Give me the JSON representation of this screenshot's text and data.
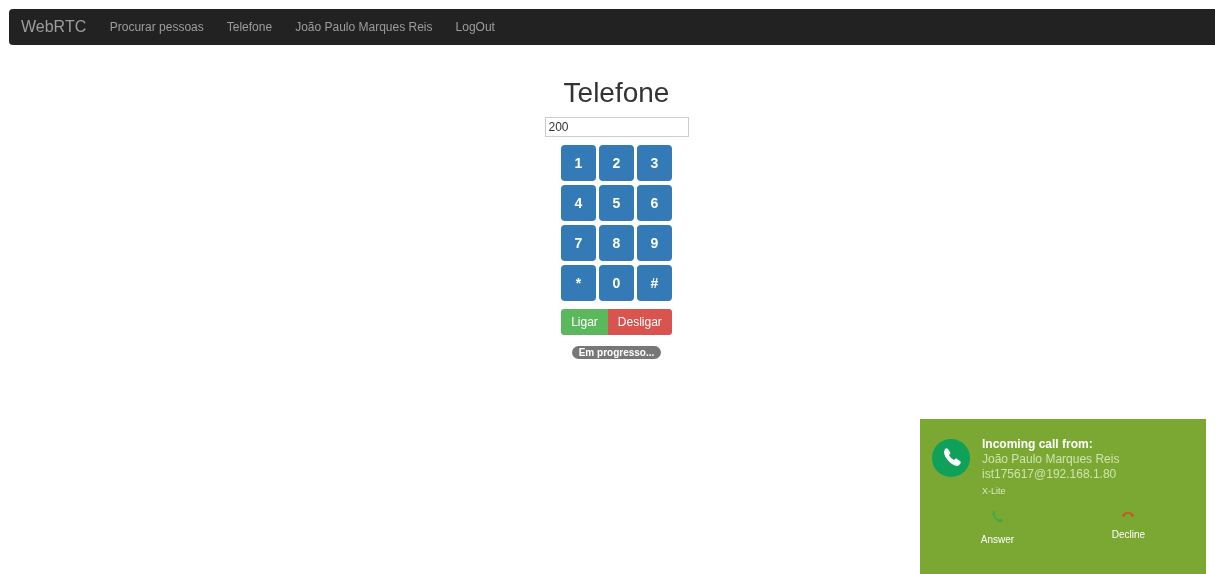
{
  "navbar": {
    "brand": "WebRTC",
    "links": [
      "Procurar pessoas",
      "Telefone",
      "João Paulo Marques Reis",
      "LogOut"
    ]
  },
  "title": "Telefone",
  "number_field": {
    "value": "200"
  },
  "keypad": [
    "1",
    "2",
    "3",
    "4",
    "5",
    "6",
    "7",
    "8",
    "9",
    "*",
    "0",
    "#"
  ],
  "actions": [
    {
      "label": "Ligar",
      "kind": "call"
    },
    {
      "label": "Desligar",
      "kind": "hangup"
    }
  ],
  "status_badge": "Em progresso...",
  "notification": {
    "heading": "Incoming call from:",
    "caller": "João Paulo Marques Reis",
    "address": "ist175617@192.168.1.80",
    "app": "X-Lite",
    "buttons": [
      {
        "label": "Answer",
        "kind": "answer"
      },
      {
        "label": "Decline",
        "kind": "decline"
      }
    ]
  }
}
